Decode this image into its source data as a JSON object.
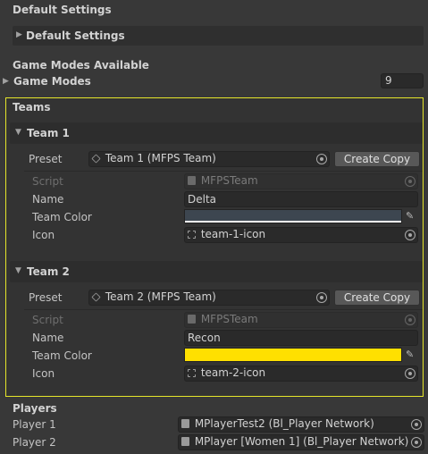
{
  "default_settings": {
    "section_title": "Default Settings",
    "foldout_label": "Default Settings"
  },
  "game_modes": {
    "section_title": "Game Modes Available",
    "label": "Game Modes",
    "value": "9"
  },
  "teams": {
    "section_title": "Teams",
    "team1": {
      "header": "Team 1",
      "preset_label": "Preset",
      "preset_value": "Team 1 (MFPS Team)",
      "create_copy": "Create Copy",
      "script_label": "Script",
      "script_value": "MFPSTeam",
      "name_label": "Name",
      "name_value": "Delta",
      "color_label": "Team Color",
      "color_value": "#3d4650",
      "icon_label": "Icon",
      "icon_value": "team-1-icon"
    },
    "team2": {
      "header": "Team 2",
      "preset_label": "Preset",
      "preset_value": "Team 2 (MFPS Team)",
      "create_copy": "Create Copy",
      "script_label": "Script",
      "script_value": "MFPSTeam",
      "name_label": "Name",
      "name_value": "Recon",
      "color_label": "Team Color",
      "color_value": "#ffe000",
      "icon_label": "Icon",
      "icon_value": "team-2-icon"
    }
  },
  "players": {
    "section_title": "Players",
    "player1_label": "Player 1",
    "player1_value": "MPlayerTest2 (Bl_Player Network)",
    "player2_label": "Player 2",
    "player2_value": "MPlayer [Women 1] (Bl_Player Network)"
  },
  "colors": {
    "teams_border": "#e6e62a",
    "background": "#383838"
  }
}
